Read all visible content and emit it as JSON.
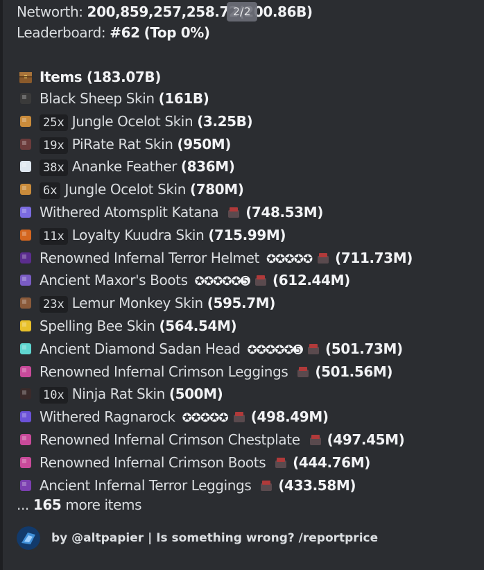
{
  "header": {
    "networth_label": "Networth: ",
    "networth_value": "200,859,257,258.72",
    "networth_short": "(200.86B)",
    "leaderboard_label": "Leaderboard: ",
    "leaderboard_rank": "#62",
    "leaderboard_top": "(Top 0%)"
  },
  "pager": {
    "label": "2/2"
  },
  "items_header": {
    "label": "Items (183.07B)",
    "icon": "chest-icon"
  },
  "items": [
    {
      "qty": "",
      "name": "Black Sheep Skin ",
      "price": "(161B)",
      "stars": "",
      "enchanted": false,
      "icon_color": "#3a3a3a"
    },
    {
      "qty": "25x",
      "name": "Jungle Ocelot Skin ",
      "price": "(3.25B)",
      "stars": "",
      "enchanted": false,
      "icon_color": "#c98b3b"
    },
    {
      "qty": "19x",
      "name": "PiRate Rat Skin ",
      "price": "(950M)",
      "stars": "",
      "enchanted": false,
      "icon_color": "#6b3b3b"
    },
    {
      "qty": "38x",
      "name": "Ananke Feather ",
      "price": "(836M)",
      "stars": "",
      "enchanted": false,
      "icon_color": "#dfe8f0"
    },
    {
      "qty": "6x",
      "name": "Jungle Ocelot Skin ",
      "price": "(780M)",
      "stars": "",
      "enchanted": false,
      "icon_color": "#c98b3b"
    },
    {
      "qty": "",
      "name": "Withered Atomsplit Katana ",
      "price": "(748.53M)",
      "stars": "",
      "enchanted": true,
      "icon_color": "#7b6be0"
    },
    {
      "qty": "11x",
      "name": "Loyalty Kuudra Skin ",
      "price": "(715.99M)",
      "stars": "",
      "enchanted": false,
      "icon_color": "#d4661f"
    },
    {
      "qty": "",
      "name": "Renowned Infernal Terror Helmet ",
      "price": "(711.73M)",
      "stars": "✪✪✪✪✪",
      "enchanted": true,
      "icon_color": "#5b2d8e"
    },
    {
      "qty": "",
      "name": "Ancient Maxor's Boots ",
      "price": "(612.44M)",
      "stars": "✪✪✪✪✪➎",
      "enchanted": true,
      "icon_color": "#7a5cc4"
    },
    {
      "qty": "23x",
      "name": "Lemur Monkey Skin ",
      "price": "(595.7M)",
      "stars": "",
      "enchanted": false,
      "icon_color": "#8a5a3a"
    },
    {
      "qty": "",
      "name": "Spelling Bee Skin ",
      "price": "(564.54M)",
      "stars": "",
      "enchanted": false,
      "icon_color": "#e8c02a"
    },
    {
      "qty": "",
      "name": "Ancient Diamond Sadan Head ",
      "price": "(501.73M)",
      "stars": "✪✪✪✪✪➎",
      "enchanted": true,
      "icon_color": "#5fd6d0"
    },
    {
      "qty": "",
      "name": "Renowned Infernal Crimson Leggings ",
      "price": "(501.56M)",
      "stars": "",
      "enchanted": true,
      "icon_color": "#c84a9a"
    },
    {
      "qty": "10x",
      "name": "Ninja Rat Skin ",
      "price": "(500M)",
      "stars": "",
      "enchanted": false,
      "icon_color": "#3a2a2a"
    },
    {
      "qty": "",
      "name": "Withered Ragnarock ",
      "price": "(498.49M)",
      "stars": "✪✪✪✪✪",
      "enchanted": true,
      "icon_color": "#6b52d8"
    },
    {
      "qty": "",
      "name": "Renowned Infernal Crimson Chestplate ",
      "price": "(497.45M)",
      "stars": "",
      "enchanted": true,
      "icon_color": "#c84a9a"
    },
    {
      "qty": "",
      "name": "Renowned Infernal Crimson Boots ",
      "price": "(444.76M)",
      "stars": "",
      "enchanted": true,
      "icon_color": "#c84a9a"
    },
    {
      "qty": "",
      "name": "Ancient Infernal Terror Leggings ",
      "price": "(433.58M)",
      "stars": "",
      "enchanted": true,
      "icon_color": "#7b3fb0"
    }
  ],
  "more_items": {
    "prefix": "... ",
    "count": "165",
    "suffix": " more items"
  },
  "footer": {
    "text": "by @altpapier | Is something wrong? /reportprice",
    "icon": "bot-avatar-icon"
  },
  "colors": {
    "background": "#2b2d31",
    "text": "#dbdee1",
    "bold": "#f2f3f5",
    "code_bg": "#1e1f22"
  }
}
